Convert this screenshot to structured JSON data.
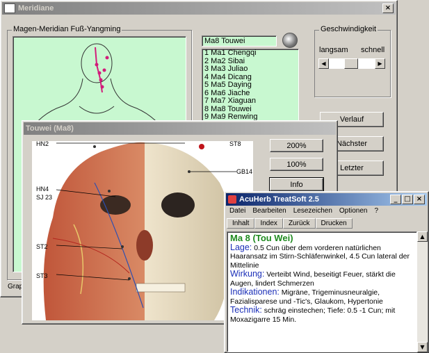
{
  "meridiane": {
    "title": "Meridiane",
    "close_glyph": "×",
    "group_title": "Magen-Meridian Fuß-Yangming",
    "selected_point": "Ma8 Touwei",
    "points": [
      "1  Ma1 Chengqi",
      "2  Ma2 Sibai",
      "3  Ma3 Juliao",
      "4  Ma4 Dicang",
      "5  Ma5 Daying",
      "6  Ma6 Jiache",
      "7  Ma7 Xiaguan",
      "8  Ma8 Touwei",
      "9  Ma9 Renwing"
    ],
    "speed_group": "Geschwindigkeit",
    "speed_slow": "langsam",
    "speed_fast": "schnell",
    "btn_verlauf": "Verlauf",
    "btn_naechster": "Nächster",
    "btn_letzter": "Letzter",
    "status_fragment": "Grap"
  },
  "touwei": {
    "title": "Touwei (Ma8)",
    "btn_200": "200%",
    "btn_100": "100%",
    "btn_info": "Info",
    "labels": {
      "hn2": "HN2",
      "st8": "ST8",
      "gb14": "GB14",
      "hn4": "HN4",
      "sj23": "SJ 23",
      "st2": "ST2",
      "st3": "ST3",
      "s": "S"
    }
  },
  "acuherb": {
    "title": "AcuHerb TreatSoft 2.5",
    "menu": [
      "Datei",
      "Bearbeiten",
      "Lesezeichen",
      "Optionen",
      "?"
    ],
    "toolbar": [
      "Inhalt",
      "Index",
      "Zurück",
      "Drucken"
    ],
    "heading": "Ma 8 (Tou Wei)",
    "lage_key": "Lage:",
    "lage_text": " 0.5 Cun über dem vorderen natürlichen Haaransatz im Stirn-Schläfenwinkel, 4.5 Cun lateral der Mittelinie",
    "wirkung_key": "Wirkung:",
    "wirkung_text": " Verteibt Wind, beseitigt Feuer, stärkt die Augen, lindert Schmerzen",
    "indik_key": "Indikationen:",
    "indik_text": " Migräne, Trigeminusneuralgie, Fazialisparese und -Tic's, Glaukom, Hypertonie",
    "technik_key": "Technik:",
    "technik_text": " schräg einstechen; Tiefe: 0.5 -1 Cun; mit Moxazigarre 15 Min."
  }
}
